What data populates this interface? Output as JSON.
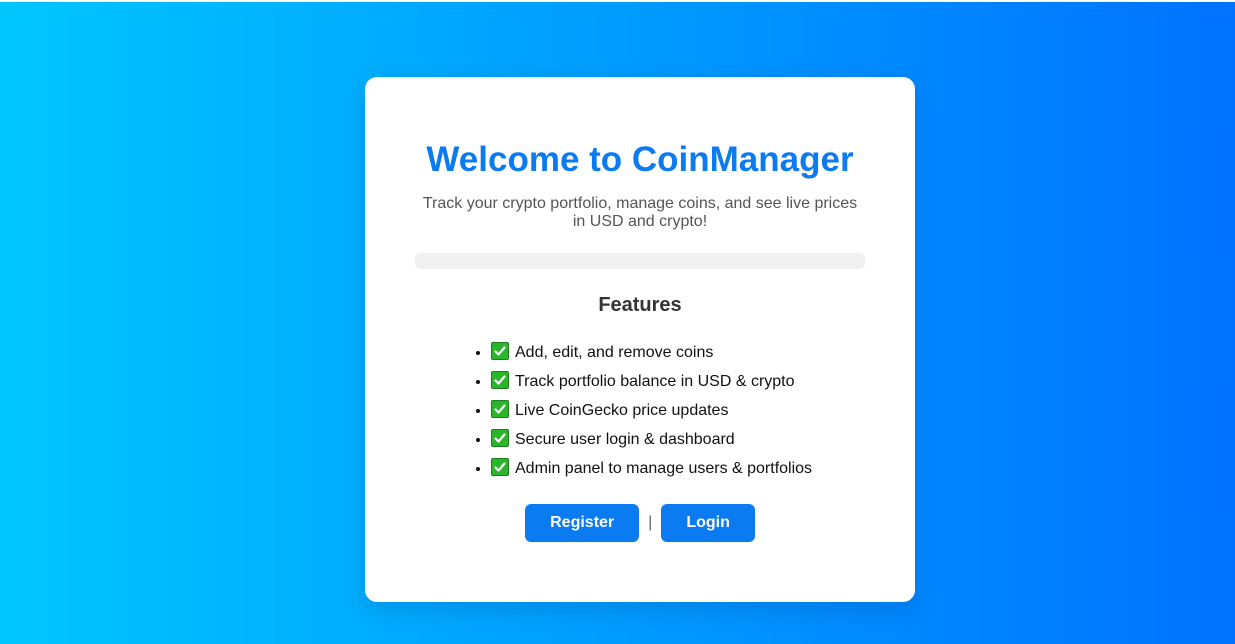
{
  "welcome": {
    "title": "Welcome to CoinManager",
    "subtitle": "Track your crypto portfolio, manage coins, and see live prices in USD and crypto!"
  },
  "features": {
    "heading": "Features",
    "items": [
      {
        "icon": "check-mark-icon",
        "label": "Add, edit, and remove coins"
      },
      {
        "icon": "check-mark-icon",
        "label": "Track portfolio balance in USD & crypto"
      },
      {
        "icon": "check-mark-icon",
        "label": "Live CoinGecko price updates"
      },
      {
        "icon": "check-mark-icon",
        "label": "Secure user login & dashboard"
      },
      {
        "icon": "check-mark-icon",
        "label": "Admin panel to manage users & portfolios"
      }
    ]
  },
  "actions": {
    "register_label": "Register",
    "separator": "|",
    "login_label": "Login"
  },
  "colors": {
    "gradient_start": "#00c6ff",
    "gradient_end": "#0072ff",
    "accent": "#0a7bf0",
    "check_green": "#2bb52b"
  }
}
